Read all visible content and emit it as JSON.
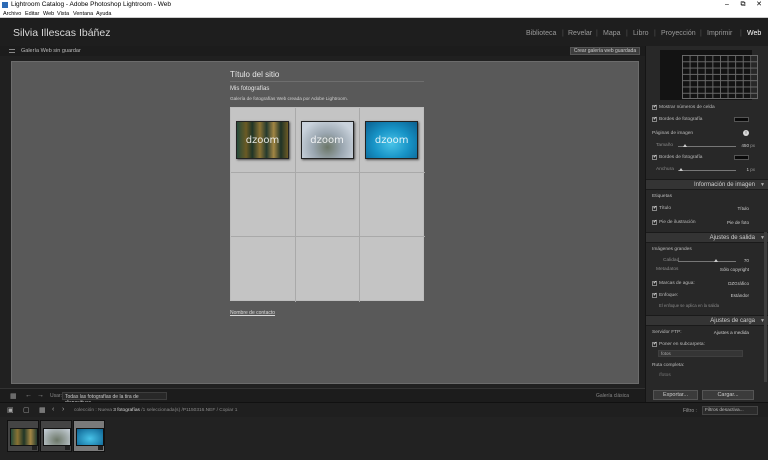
{
  "window": {
    "title": "Lightroom Catalog - Adobe Photoshop Lightroom - Web",
    "buttons": [
      "–",
      "⧉",
      "✕"
    ]
  },
  "menu": [
    "Archivo",
    "Editar",
    "Web",
    "Vista",
    "Ventana",
    "Ayuda"
  ],
  "identity": {
    "name": "Silvia Illescas Ibáñez"
  },
  "modules": [
    {
      "label": "Biblioteca",
      "active": false
    },
    {
      "label": "Revelar",
      "active": false
    },
    {
      "label": "Mapa",
      "active": false
    },
    {
      "label": "Libro",
      "active": false
    },
    {
      "label": "Proyección",
      "active": false
    },
    {
      "label": "Imprimir",
      "active": false
    },
    {
      "label": "Web",
      "active": true
    }
  ],
  "topbar": {
    "gallery_title": "Galería Web sin guardar",
    "save_button": "Crear galería web guardada"
  },
  "preview": {
    "site_title": "Título del sitio",
    "collection_title": "Mis fotografías",
    "collection_description": "Galería de fotografías Web creada por Adobe Lightroom.",
    "watermark": "dzoom",
    "contact_link": "Nombre de contacto"
  },
  "toolbar": {
    "use_label": "Usar:",
    "use_value": "Todas las fotografías de la tira de diapositivas",
    "gallery_name": "Galería clásica"
  },
  "right_panel": {
    "site_layout": {
      "show_cell_numbers": "Mostrar números de celda",
      "photo_borders": "Bordes de fotografía"
    },
    "image_pages": {
      "title": "Páginas de imagen",
      "size_label": "Tamaño",
      "size_value": "450",
      "size_unit": "px",
      "photo_borders": "Bordes de fotografía",
      "width_label": "Anchura",
      "width_value": "1",
      "width_unit": "px"
    },
    "image_info": {
      "section": "Información de imagen",
      "labels_heading": "Etiquetas",
      "title_label": "Título",
      "title_value": "Título",
      "caption_label": "Pie de ilustración",
      "caption_value": "Pie de foto"
    },
    "output": {
      "section": "Ajustes de salida",
      "large_images": "Imágenes grandes",
      "quality_label": "Calidad",
      "quality_value": "70",
      "metadata_label": "Metadatos",
      "metadata_value": "Sólo copyright",
      "watermark_label": "Marcas de agua:",
      "watermark_value": "DZGráfico",
      "sharpen_label": "Enfoque:",
      "sharpen_value": "Estándor",
      "sharpen_note": "El enfoque se aplica en la salida"
    },
    "upload": {
      "section": "Ajustes de carga",
      "ftp_label": "Servidor FTP:",
      "ftp_value": "Ajustes a medida",
      "subfolder_label": "Poner en subcarpeta:",
      "subfolder_value": "fotos",
      "full_path_label": "Ruta completa:",
      "full_path_value": "/fotos"
    },
    "export_button": "Exportar...",
    "upload_button": "Cargar..."
  },
  "filmstrip": {
    "prefix": "colección : Nueva",
    "count": "3 fotografías",
    "detail": "/1 seleccionada(s) /P1150316.NEF / Copiar 1",
    "filter_label": "Filtro :",
    "filter_value": "Filtros desactiva..."
  },
  "colors": {
    "panel": "#282828",
    "canvas": "#595959",
    "grid": "#c4c4c4",
    "active_module": "#ffffff"
  }
}
